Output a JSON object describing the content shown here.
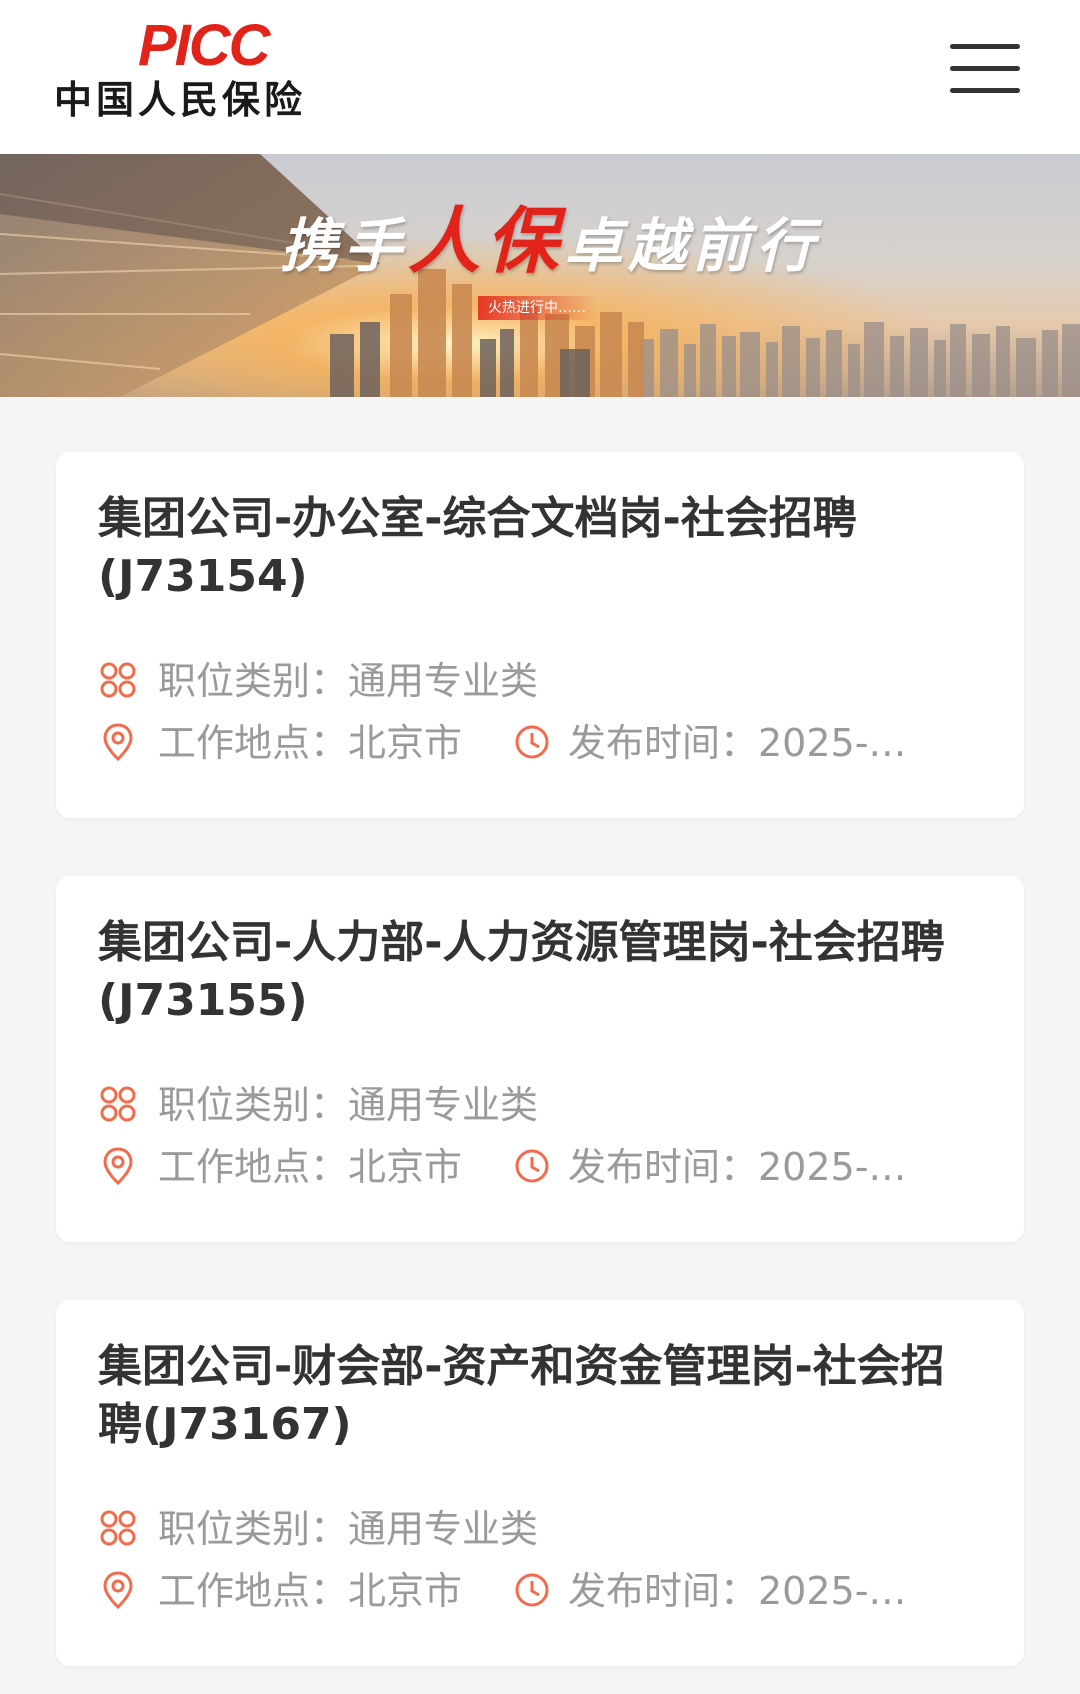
{
  "header": {
    "logo_en": "PICC",
    "logo_cn": "中国人民保险",
    "menu_icon": "hamburger-menu-icon"
  },
  "banner": {
    "slogan_prefix": "携手",
    "slogan_highlight": "人保",
    "slogan_suffix": "卓越前行",
    "tag": "火热进行中……"
  },
  "colors": {
    "brand_red": "#e2231a",
    "icon_orange": "#f26b4a",
    "meta_gray": "#9a9a9a",
    "title_dark": "#333333",
    "page_bg": "#f5f5f5"
  },
  "jobs": [
    {
      "title": "集团公司-办公室-综合文档岗-社会招聘(J73154)",
      "category_label": "职位类别：",
      "category": "通用专业类",
      "location_label": "工作地点：",
      "location": "北京市",
      "date_label": "发布时间：",
      "date": "2025-…"
    },
    {
      "title": "集团公司-人力部-人力资源管理岗-社会招聘(J73155)",
      "category_label": "职位类别：",
      "category": "通用专业类",
      "location_label": "工作地点：",
      "location": "北京市",
      "date_label": "发布时间：",
      "date": "2025-…"
    },
    {
      "title": "集团公司-财会部-资产和资金管理岗-社会招聘(J73167)",
      "category_label": "职位类别：",
      "category": "通用专业类",
      "location_label": "工作地点：",
      "location": "北京市",
      "date_label": "发布时间：",
      "date": "2025-…"
    }
  ]
}
